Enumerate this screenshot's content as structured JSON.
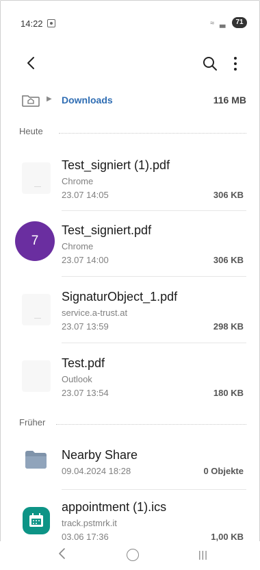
{
  "status": {
    "time": "14:22",
    "battery": "71"
  },
  "breadcrumb": {
    "folder": "Downloads",
    "size": "116 MB"
  },
  "sections": {
    "today": "Heute",
    "earlier": "Früher"
  },
  "files": [
    {
      "name": "Test_signiert (1).pdf",
      "source": "Chrome",
      "date": "23.07 14:05",
      "size": "306 KB"
    },
    {
      "name": "Test_signiert.pdf",
      "source": "Chrome",
      "date": "23.07 14:00",
      "size": "306 KB"
    },
    {
      "name": "SignaturObject_1.pdf",
      "source": "service.a-trust.at",
      "date": "23.07 13:59",
      "size": "298 KB"
    },
    {
      "name": "Test.pdf",
      "source": "Outlook",
      "date": "23.07 13:54",
      "size": "180 KB"
    }
  ],
  "earlier_items": [
    {
      "name": "Nearby Share",
      "date": "09.04.2024 18:28",
      "size": "0 Objekte"
    },
    {
      "name": "appointment (1).ics",
      "source": "track.pstmrk.it",
      "date": "03.06 17:36",
      "size": "1,00 KB"
    }
  ],
  "overlay_badge": "7",
  "colors": {
    "accent": "#2f6db3",
    "badge": "#6a2ea0",
    "calendar": "#0d9486",
    "folder": "#7f93aa"
  },
  "icons": {
    "back": "chevron-left-icon",
    "search": "search-icon",
    "more": "more-vert-icon",
    "home": "home-folder-icon"
  }
}
